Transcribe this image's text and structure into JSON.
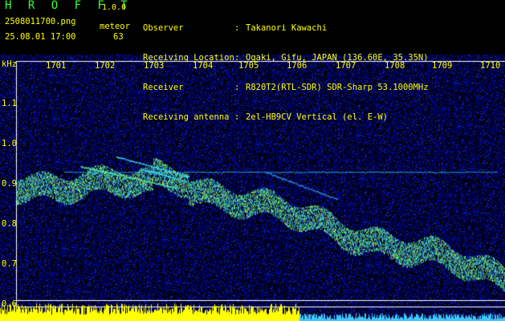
{
  "header": {
    "brand": "H R O F F T",
    "version": "1.0.0",
    "filename": "2508011700.png",
    "meteor_label": "meteor",
    "datetime": "25.08.01 17:00",
    "meteor_count": "63",
    "info": [
      {
        "key": "Observer",
        "sep": ":",
        "value": "Takanori Kawachi"
      },
      {
        "key": "Receiving Location",
        "sep": ":",
        "value": "Ogaki, Gifu, JAPAN (136.60E, 35.35N)"
      },
      {
        "key": "Receiver",
        "sep": ":",
        "value": "R820T2(RTL-SDR) SDR-Sharp 53.1000MHz"
      },
      {
        "key": "Receiving antenna",
        "sep": ":",
        "value": "2el-HB9CV Vertical (el. E-W)"
      }
    ]
  },
  "axis": {
    "y_unit": "kHz",
    "y_labels": [
      "1.1",
      "1.0",
      "0.9",
      "0.8",
      "0.7",
      "0.6"
    ],
    "x_labels": [
      "1701",
      "1702",
      "1703",
      "1704",
      "1705",
      "1706",
      "1707",
      "1708",
      "1709",
      "1710"
    ]
  },
  "colors": {
    "text_yellow": "#ffff00",
    "text_green": "#39ff39",
    "noise_blue": "#1030c0",
    "signal_cyan": "#40e0ff",
    "signal_green": "#60ff60",
    "signal_yellow": "#ffff40",
    "level_yellow": "#ffff00",
    "level_cyan": "#40c8ff"
  }
}
